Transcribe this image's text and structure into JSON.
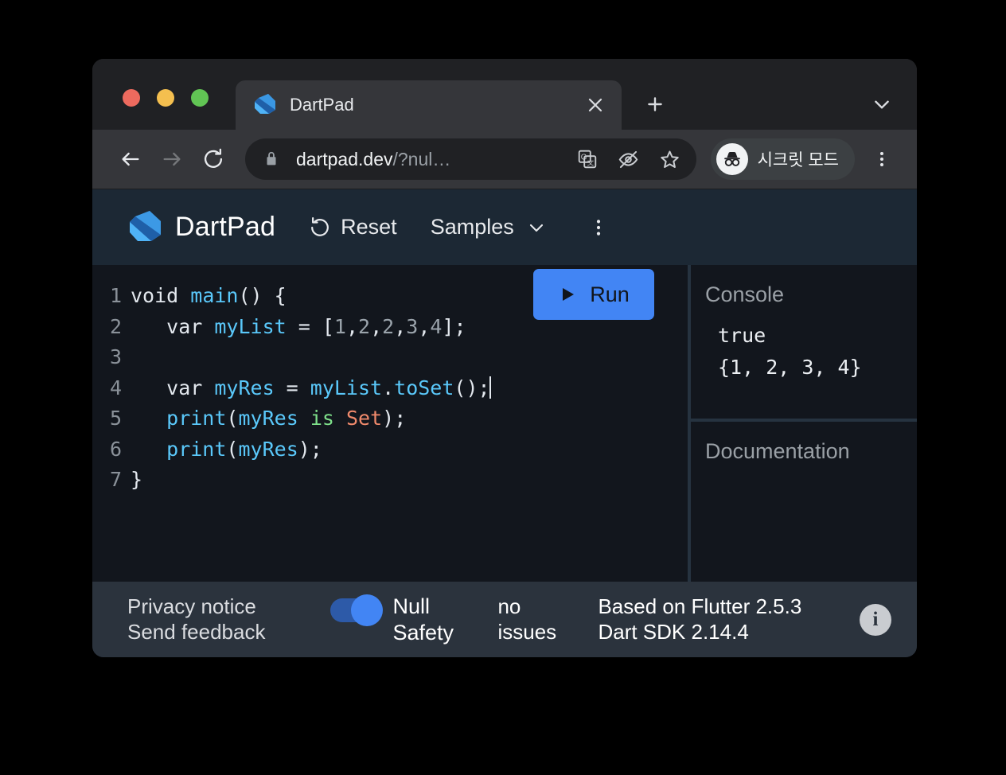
{
  "browser": {
    "traffic_lights": [
      "close",
      "minimize",
      "maximize"
    ],
    "tab": {
      "title": "DartPad",
      "favicon": "dart-logo-icon",
      "close_icon": "close-icon"
    },
    "new_tab_icon": "plus-icon",
    "tab_list_chevron_icon": "chevron-down-icon",
    "toolbar": {
      "back_icon": "back-arrow-icon",
      "forward_icon": "forward-arrow-icon",
      "reload_icon": "reload-icon",
      "lock_icon": "lock-icon",
      "url_host": "dartpad.dev",
      "url_suffix": "/?nul…",
      "translate_icon": "translate-icon",
      "hide_icon": "eye-off-icon",
      "bookmark_icon": "star-icon",
      "incognito_icon": "incognito-icon",
      "incognito_label": "시크릿 모드",
      "menu_icon": "kebab-menu-icon"
    }
  },
  "dartpad": {
    "header": {
      "logo_icon": "dart-logo-icon",
      "brand": "DartPad",
      "reset_icon": "reload-icon",
      "reset_label": "Reset",
      "samples_label": "Samples",
      "samples_chevron_icon": "chevron-down-icon",
      "more_icon": "kebab-menu-icon"
    },
    "editor": {
      "run_button": {
        "label": "Run",
        "play_icon": "play-triangle-icon",
        "color": "#4285f4"
      },
      "lines": [
        {
          "number": "1",
          "tokens": [
            {
              "t": "void ",
              "c": "kw"
            },
            {
              "t": "main",
              "c": "fn"
            },
            {
              "t": "() {",
              "c": "punct"
            }
          ]
        },
        {
          "number": "2",
          "tokens": [
            {
              "t": "   var ",
              "c": "kw"
            },
            {
              "t": "myList",
              "c": "ident"
            },
            {
              "t": " = [",
              "c": "punct"
            },
            {
              "t": "1",
              "c": "num"
            },
            {
              "t": ",",
              "c": "punct"
            },
            {
              "t": "2",
              "c": "num"
            },
            {
              "t": ",",
              "c": "punct"
            },
            {
              "t": "2",
              "c": "num"
            },
            {
              "t": ",",
              "c": "punct"
            },
            {
              "t": "3",
              "c": "num"
            },
            {
              "t": ",",
              "c": "punct"
            },
            {
              "t": "4",
              "c": "num"
            },
            {
              "t": "];",
              "c": "punct"
            }
          ]
        },
        {
          "number": "3",
          "tokens": []
        },
        {
          "number": "4",
          "tokens": [
            {
              "t": "   var ",
              "c": "kw"
            },
            {
              "t": "myRes",
              "c": "ident"
            },
            {
              "t": " = ",
              "c": "punct"
            },
            {
              "t": "myList",
              "c": "ident"
            },
            {
              "t": ".",
              "c": "punct"
            },
            {
              "t": "toSet",
              "c": "fn"
            },
            {
              "t": "();",
              "c": "punct"
            },
            {
              "t": "",
              "c": "caret"
            }
          ]
        },
        {
          "number": "5",
          "tokens": [
            {
              "t": "   ",
              "c": "punct"
            },
            {
              "t": "print",
              "c": "fn"
            },
            {
              "t": "(",
              "c": "punct"
            },
            {
              "t": "myRes",
              "c": "ident"
            },
            {
              "t": " ",
              "c": "punct"
            },
            {
              "t": "is",
              "c": "op"
            },
            {
              "t": " ",
              "c": "punct"
            },
            {
              "t": "Set",
              "c": "type"
            },
            {
              "t": ");",
              "c": "punct"
            }
          ]
        },
        {
          "number": "6",
          "tokens": [
            {
              "t": "   ",
              "c": "punct"
            },
            {
              "t": "print",
              "c": "fn"
            },
            {
              "t": "(",
              "c": "punct"
            },
            {
              "t": "myRes",
              "c": "ident"
            },
            {
              "t": ");",
              "c": "punct"
            }
          ]
        },
        {
          "number": "7",
          "tokens": [
            {
              "t": "}",
              "c": "punct"
            }
          ]
        }
      ]
    },
    "console": {
      "title": "Console",
      "output": "true\n{1, 2, 3, 4}"
    },
    "documentation": {
      "title": "Documentation",
      "content": ""
    },
    "footer": {
      "privacy_notice": "Privacy notice",
      "send_feedback": "Send feedback",
      "null_safety_label": "Null Safety",
      "null_safety_enabled": true,
      "issues": "no issues",
      "flutter_version": "Based on Flutter 2.5.3",
      "dart_version": "Dart SDK 2.14.4",
      "info_icon": "info-icon",
      "info_glyph": "i"
    }
  }
}
